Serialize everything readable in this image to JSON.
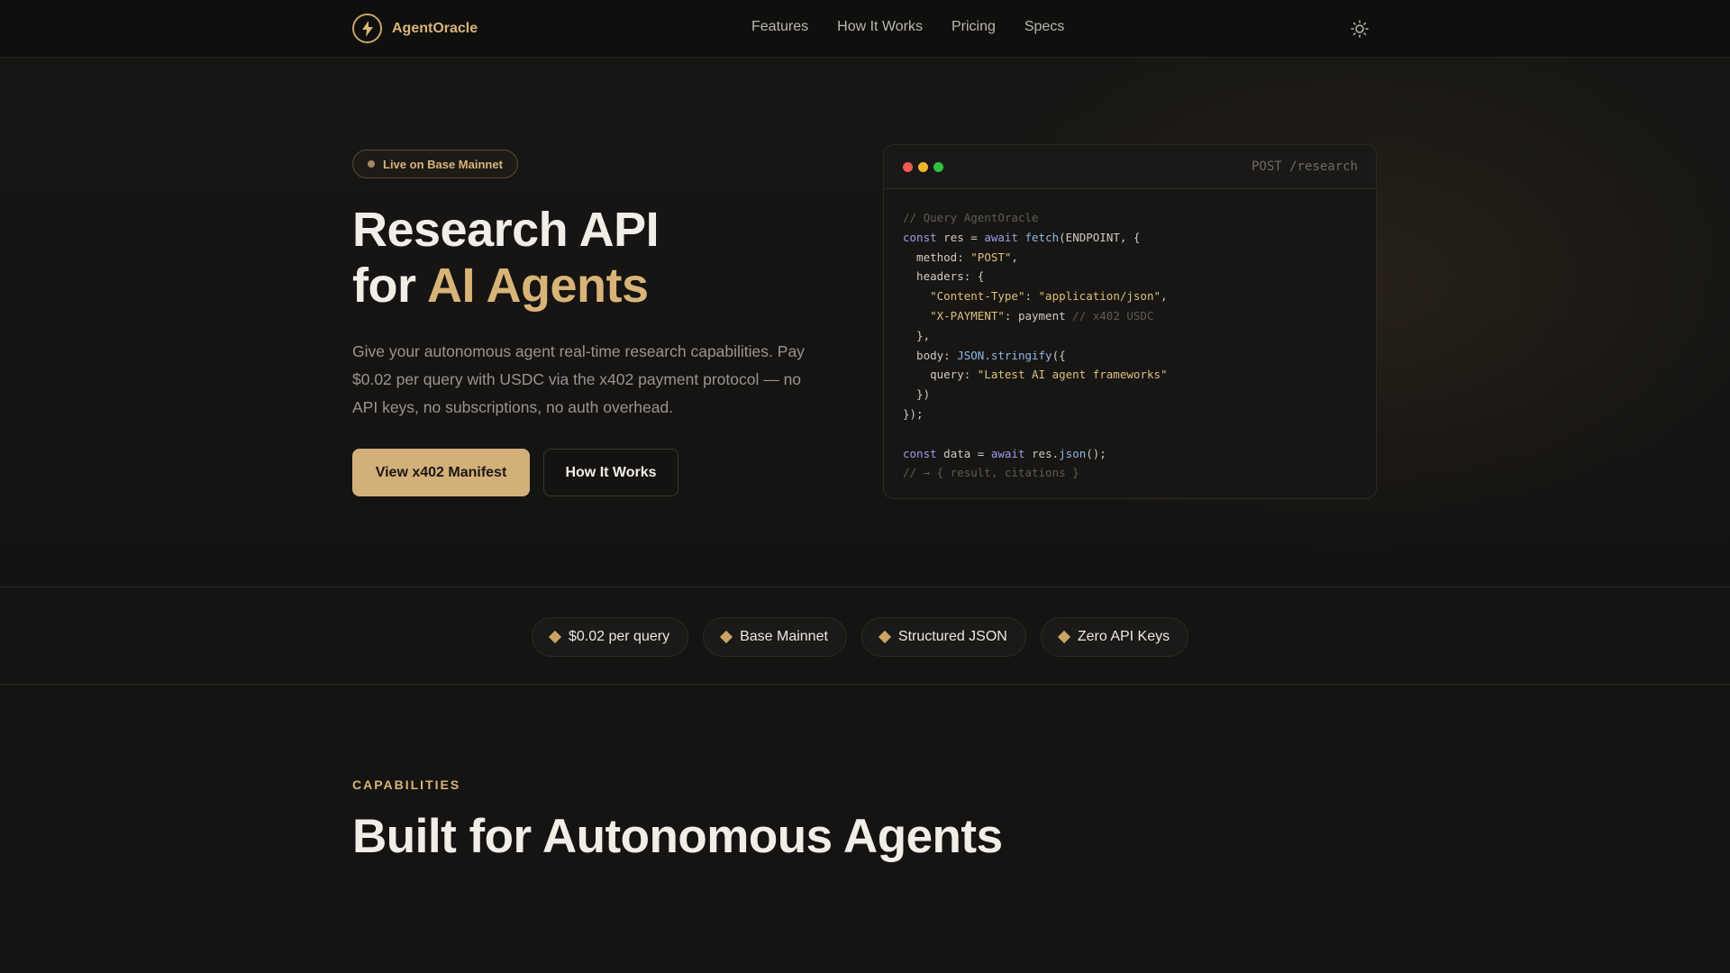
{
  "nav": {
    "brand": "AgentOracle",
    "links": [
      "Features",
      "How It Works",
      "Pricing",
      "Specs"
    ]
  },
  "hero": {
    "badge": "Live on Base Mainnet",
    "title_line1": "Research API",
    "title_line2_prefix": "for ",
    "title_line2_accent": "AI Agents",
    "subtitle": "Give your autonomous agent real-time research capabilities. Pay $0.02 per query with USDC via the x402 payment protocol — no API keys, no subscriptions, no auth overhead.",
    "primary_button": "View x402 Manifest",
    "secondary_button": "How It Works"
  },
  "code": {
    "endpoint": "POST /research",
    "lines": [
      [
        [
          "c-cm",
          "// Query AgentOracle"
        ]
      ],
      [
        [
          "c-kw",
          "const"
        ],
        [
          "c-pl",
          " res = "
        ],
        [
          "c-kw",
          "await"
        ],
        [
          "c-pl",
          " "
        ],
        [
          "c-fn",
          "fetch"
        ],
        [
          "c-pl",
          "(ENDPOINT, {"
        ]
      ],
      [
        [
          "c-pl",
          "  method: "
        ],
        [
          "c-st",
          "\"POST\""
        ],
        [
          "c-pl",
          ","
        ]
      ],
      [
        [
          "c-pl",
          "  headers: {"
        ]
      ],
      [
        [
          "c-pl",
          "    "
        ],
        [
          "c-st",
          "\"Content-Type\""
        ],
        [
          "c-pl",
          ": "
        ],
        [
          "c-st",
          "\"application/json\""
        ],
        [
          "c-pl",
          ","
        ]
      ],
      [
        [
          "c-pl",
          "    "
        ],
        [
          "c-st",
          "\"X-PAYMENT\""
        ],
        [
          "c-pl",
          ": payment "
        ],
        [
          "c-cm",
          "// x402 USDC"
        ]
      ],
      [
        [
          "c-pl",
          "  },"
        ]
      ],
      [
        [
          "c-pl",
          "  body: "
        ],
        [
          "c-fn",
          "JSON.stringify"
        ],
        [
          "c-pl",
          "({"
        ]
      ],
      [
        [
          "c-pl",
          "    query: "
        ],
        [
          "c-st",
          "\"Latest AI agent frameworks\""
        ]
      ],
      [
        [
          "c-pl",
          "  })"
        ]
      ],
      [
        [
          "c-pl",
          "});"
        ]
      ],
      [
        [
          "c-pl",
          ""
        ]
      ],
      [
        [
          "c-kw",
          "const"
        ],
        [
          "c-pl",
          " data = "
        ],
        [
          "c-kw",
          "await"
        ],
        [
          "c-pl",
          " res."
        ],
        [
          "c-fn",
          "json"
        ],
        [
          "c-pl",
          "();"
        ]
      ],
      [
        [
          "c-cm",
          "// → { result, citations }"
        ]
      ]
    ]
  },
  "features": [
    "$0.02 per query",
    "Base Mainnet",
    "Structured JSON",
    "Zero API Keys"
  ],
  "capabilities": {
    "eyebrow": "CAPABILITIES",
    "title": "Built for Autonomous Agents"
  },
  "colors": {
    "accent": "#d8b478",
    "background": "#151413",
    "icons": [
      "bolt-icon",
      "sun-icon",
      "diamond-icon"
    ]
  }
}
